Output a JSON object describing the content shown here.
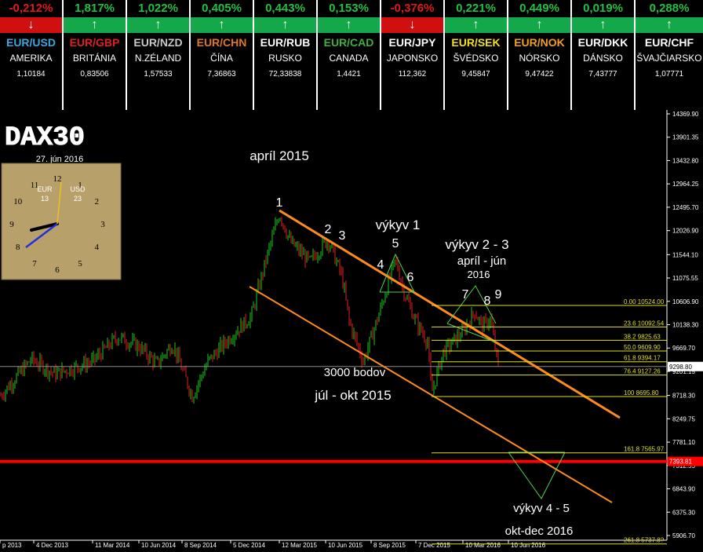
{
  "ticker": [
    {
      "pct": "-0,212%",
      "dir": "down",
      "pair": "EUR/USD",
      "pair_color": "#3aa8e0",
      "country": "AMERIKA",
      "rate": "1,10184"
    },
    {
      "pct": "1,817%",
      "dir": "up",
      "pair": "EUR/GBP",
      "pair_color": "#e02020",
      "country": "BRITÁNIA",
      "rate": "0,83506"
    },
    {
      "pct": "1,022%",
      "dir": "up",
      "pair": "EUR/NZD",
      "pair_color": "#c8c8c8",
      "country": "N.ZÉLAND",
      "rate": "1,57533"
    },
    {
      "pct": "0,405%",
      "dir": "up",
      "pair": "EUR/CHN",
      "pair_color": "#e07820",
      "country": "ČÍNA",
      "rate": "7,36863"
    },
    {
      "pct": "0,443%",
      "dir": "up",
      "pair": "EUR/RUB",
      "pair_color": "#ffffff",
      "country": "RUSKO",
      "rate": "72,33838"
    },
    {
      "pct": "0,153%",
      "dir": "up",
      "pair": "EUR/CAD",
      "pair_color": "#40b040",
      "country": "CANADA",
      "rate": "1,4421"
    },
    {
      "pct": "-0,376%",
      "dir": "down",
      "pair": "EUR/JPY",
      "pair_color": "#ffffff",
      "country": "JAPONSKO",
      "rate": "112,362"
    },
    {
      "pct": "0,221%",
      "dir": "up",
      "pair": "EUR/SEK",
      "pair_color": "#f0e020",
      "country": "ŠVÉDSKO",
      "rate": "9,45847"
    },
    {
      "pct": "0,449%",
      "dir": "up",
      "pair": "EUR/NOK",
      "pair_color": "#f0a020",
      "country": "NÓRSKO",
      "rate": "9,47422"
    },
    {
      "pct": "0,019%",
      "dir": "up",
      "pair": "EUR/DKK",
      "pair_color": "#ffffff",
      "country": "DÁNSKO",
      "rate": "7,43777"
    },
    {
      "pct": "0,288%",
      "dir": "up",
      "pair": "EUR/CHF",
      "pair_color": "#ffffff",
      "country": "ŠVAJČIARSKO",
      "rate": "1,07771"
    }
  ],
  "colors": {
    "up": "#20c040",
    "down": "#e01818",
    "up_bg": "#14a84a",
    "down_bg": "#d01010"
  },
  "chart_title": "DAX30",
  "clock": {
    "date": "27. jún 2016",
    "eur_label": "EUR",
    "eur_value": "13",
    "usd_label": "USD",
    "usd_value": "23",
    "numerals": [
      "12",
      "1",
      "2",
      "3",
      "4",
      "5",
      "6",
      "7",
      "8",
      "9",
      "10",
      "11"
    ]
  },
  "annotations": {
    "apr2015": "apríl 2015",
    "p1": "1",
    "p2": "2",
    "p3": "3",
    "p4": "4",
    "p5": "5",
    "p6": "6",
    "p7": "7",
    "p8": "8",
    "p9": "9",
    "vykyv1": "výkyv 1",
    "vykyv23": "výkyv 2 - 3",
    "aprjun": "apríl - jún",
    "y2016": "2016",
    "bodov": "3000 bodov",
    "julokt": "júl - okt 2015",
    "vykyv45": "výkyv 4 - 5",
    "oktdec": "okt-dec 2016"
  },
  "chart_data": {
    "type": "line",
    "title": "DAX30",
    "price_axis": {
      "min": 5906.76,
      "max": 14369.9,
      "ticks": [
        "14369.90",
        "13901.35",
        "13432.80",
        "12964.25",
        "12495.70",
        "12026.90",
        "11544.10",
        "11075.55",
        "10606.90",
        "10138.30",
        "9669.70",
        "9201.15",
        "8718.30",
        "8249.75",
        "7781.10",
        "7312.55",
        "6843.90",
        "6375.30",
        "5906.70"
      ]
    },
    "time_axis": [
      "p 2013",
      "4 Dec 2013",
      "11 Mar 2014",
      "10 Jun 2014",
      "8 Sep 2014",
      "5 Dec 2014",
      "12 Mar 2015",
      "10 Jun 2015",
      "8 Sep 2015",
      "7 Dec 2015",
      "10 Mar 2016",
      "10 Jun 2016"
    ],
    "current_price": "9298.80",
    "red_level": "7393.81",
    "fibonacci": [
      {
        "ratio": "0.00",
        "price": "10524.00"
      },
      {
        "ratio": "23.6",
        "price": "10092.54"
      },
      {
        "ratio": "38.2",
        "price": "9825.63"
      },
      {
        "ratio": "50.0",
        "price": "9609.90"
      },
      {
        "ratio": "61.8",
        "price": "9394.17"
      },
      {
        "ratio": "76.4",
        "price": "9127.26"
      },
      {
        "ratio": "100",
        "price": "8695.80"
      },
      {
        "ratio": "161.8",
        "price": "7565.97"
      },
      {
        "ratio": "261.8",
        "price": "5737.8?"
      }
    ],
    "series_points": [
      [
        "Oct 2013",
        8700
      ],
      [
        "Dec 2013",
        9400
      ],
      [
        "Mar 2014",
        9400
      ],
      [
        "Jun 2014",
        9900
      ],
      [
        "Aug 2014",
        9000
      ],
      [
        "Sep 2014",
        9700
      ],
      [
        "Oct 2014",
        8700
      ],
      [
        "Dec 2014",
        9900
      ],
      [
        "Jan 2015",
        10100
      ],
      [
        "Mar 2015",
        12000
      ],
      [
        "Apr 2015",
        12375
      ],
      [
        "May 2015",
        11400
      ],
      [
        "Jun 2015",
        11800
      ],
      [
        "Jul 2015",
        11200
      ],
      [
        "Aug 2015",
        10000
      ],
      [
        "Sep 2015",
        9400
      ],
      [
        "Oct 2015",
        10200
      ],
      [
        "Nov 2015",
        11300
      ],
      [
        "Dec 2015",
        10400
      ],
      [
        "Jan 2016",
        9800
      ],
      [
        "Feb 2016",
        8750
      ],
      [
        "Mar 2016",
        10000
      ],
      [
        "Apr 2016",
        10400
      ],
      [
        "May 2016",
        9800
      ],
      [
        "Jun 2016",
        10200
      ],
      [
        "27 Jun 2016",
        9300
      ]
    ]
  }
}
